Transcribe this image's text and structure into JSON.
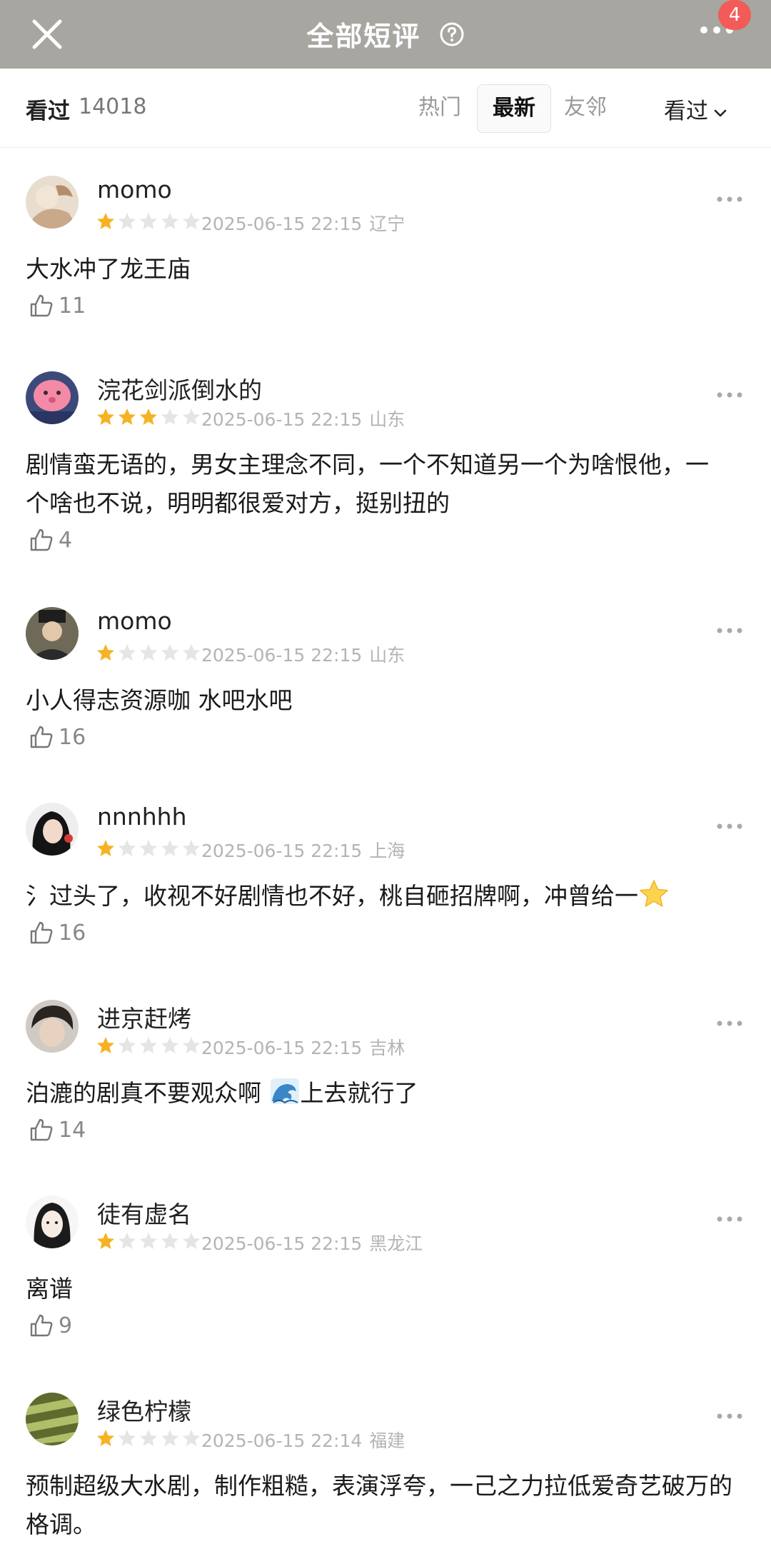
{
  "header": {
    "title": "全部短评",
    "badge_count": "4"
  },
  "filter": {
    "seen_label": "看过",
    "seen_count": "14018",
    "tabs": [
      "热门",
      "最新",
      "友邻"
    ],
    "active_tab": "最新",
    "seen_dropdown": "看过"
  },
  "comments": [
    {
      "user": "momo",
      "rating": 1,
      "date": "2025-06-15 22:15",
      "location": "辽宁",
      "text": "大水冲了龙王庙",
      "likes": "11"
    },
    {
      "user": "浣花剑派倒水的",
      "rating": 3,
      "date": "2025-06-15 22:15",
      "location": "山东",
      "text": "剧情蛮无语的，男女主理念不同，一个不知道另一个为啥恨他，一个啥也不说，明明都很爱对方，挺别扭的",
      "likes": "4"
    },
    {
      "user": "momo",
      "rating": 1,
      "date": "2025-06-15 22:15",
      "location": "山东",
      "text": "小人得志资源咖 水吧水吧",
      "likes": "16"
    },
    {
      "user": "nnnhhh",
      "rating": 1,
      "date": "2025-06-15 22:15",
      "location": "上海",
      "text": "氵过头了，收视不好剧情也不好，桃自砸招牌啊，冲曾给一",
      "likes": "16"
    },
    {
      "user": "进京赶烤",
      "rating": 1,
      "date": "2025-06-15 22:15",
      "location": "吉林",
      "text_before": "泊漉的剧真不要观众啊 ",
      "text_after": "上去就行了",
      "likes": "14"
    },
    {
      "user": "徒有虚名",
      "rating": 1,
      "date": "2025-06-15 22:15",
      "location": "黑龙江",
      "text": "离谱",
      "likes": "9"
    },
    {
      "user": "绿色柠檬",
      "rating": 1,
      "date": "2025-06-15 22:14",
      "location": "福建",
      "text": "预制超级大水剧，制作粗糙，表演浮夸，一己之力拉低爱奇艺破万的格调。",
      "likes": ""
    }
  ],
  "icons": {
    "close": "close-icon",
    "help": "help-circle-icon",
    "more": "more-dots-icon",
    "chevron": "chevron-down-icon",
    "like": "thumbs-up-icon",
    "star": "star-icon"
  },
  "colors": {
    "header_bg": "#a8a6a0",
    "star_on": "#f5b324",
    "star_off": "#e5e5e5",
    "badge": "#f25b58"
  }
}
